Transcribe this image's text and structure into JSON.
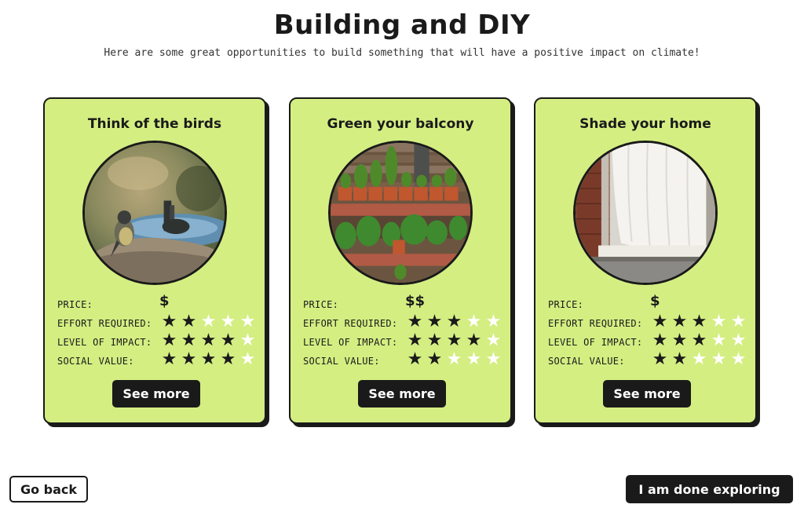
{
  "page": {
    "title": "Building and DIY",
    "subtitle": "Here are some great opportunities to build something that will have a positive impact on climate!"
  },
  "labels": {
    "price": "PRICE:",
    "effort": "EFFORT REQUIRED:",
    "impact": "LEVEL OF IMPACT:",
    "social": "SOCIAL VALUE:"
  },
  "cards": [
    {
      "title": "Think of the birds",
      "image": "bird-bath-photo",
      "price": "$",
      "effort": 2,
      "impact": 4,
      "social": 4,
      "button": "See more"
    },
    {
      "title": "Green your balcony",
      "image": "balcony-plants-photo",
      "price": "$$",
      "effort": 3,
      "impact": 4,
      "social": 2,
      "button": "See more"
    },
    {
      "title": "Shade your home",
      "image": "window-curtain-photo",
      "price": "$",
      "effort": 3,
      "impact": 3,
      "social": 2,
      "button": "See more"
    }
  ],
  "star_max": 5,
  "footer": {
    "back_label": "Go back",
    "done_label": "I am done exploring"
  },
  "colors": {
    "card_bg": "#d4ee82",
    "ink": "#1a1a1a",
    "star_off": "#ffffff"
  }
}
